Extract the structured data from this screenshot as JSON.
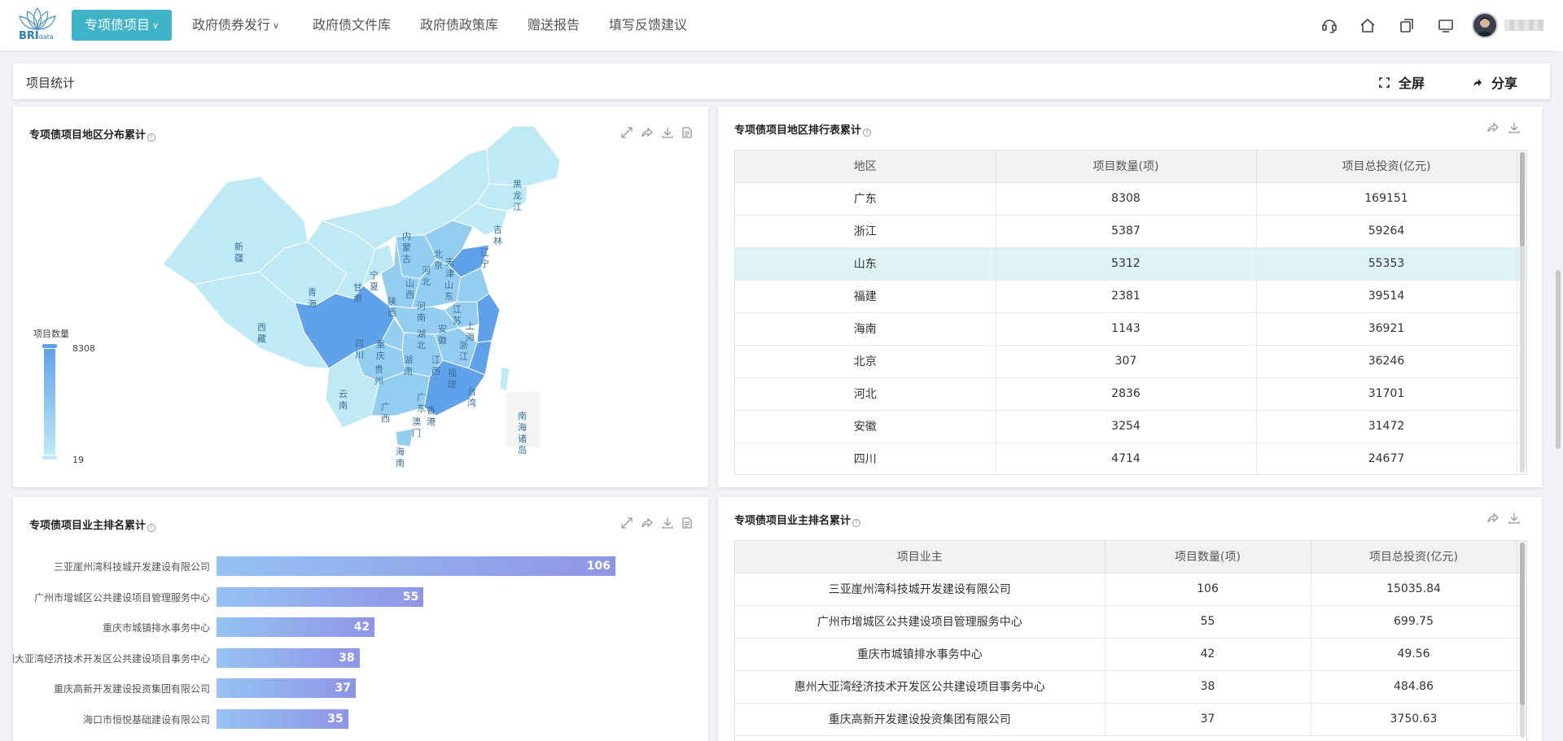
{
  "nav": {
    "logo_text": "BRI",
    "logo_sub": "data",
    "active": "专项债项目",
    "items": [
      "政府债券发行",
      "政府债文件库",
      "政府债政策库",
      "赠送报告",
      "填写反馈建议"
    ]
  },
  "statbar": {
    "title": "项目统计",
    "fullscreen": "全屏",
    "share": "分享"
  },
  "map_panel": {
    "title": "专项债项目地区分布累计",
    "legend_title": "项目数量",
    "legend_max": "8308",
    "legend_min": "19",
    "labels": {
      "xinjiang": "新疆",
      "xizang": "西藏",
      "qinghai": "青海",
      "gansu": "甘肃",
      "neimenggu": "内蒙古",
      "heilongjiang": "黑龙江",
      "jilin": "吉林",
      "liaoning": "辽宁",
      "beijing": "北京",
      "tianjin": "天津",
      "hebei": "河北",
      "shanxi": "山西",
      "shandong": "山东",
      "ningxia": "宁夏",
      "shaanxi": "陕西",
      "henan": "河南",
      "jiangsu": "江苏",
      "shanghai": "上海",
      "anhui": "安徽",
      "hubei": "湖北",
      "zhejiang": "浙江",
      "sichuan": "四川",
      "chongqing": "重庆",
      "hunan": "湖南",
      "jiangxi": "江西",
      "guizhou": "贵州",
      "fujian": "福建",
      "yunnan": "云南",
      "guangxi": "广西",
      "guangdong": "广东",
      "aomen": "澳门",
      "xianggang": "香港",
      "taiwan": "台湾",
      "hainan": "海南",
      "nanhai": "南海诸岛"
    },
    "colors": {
      "low": "#bfeaf5",
      "mid": "#93cdef",
      "high": "#5fa2ea"
    }
  },
  "region_table": {
    "title": "专项债项目地区排行表累计",
    "headers": [
      "地区",
      "项目数量(项)",
      "项目总投资(亿元)"
    ],
    "rows": [
      [
        "广东",
        "8308",
        "169151"
      ],
      [
        "浙江",
        "5387",
        "59264"
      ],
      [
        "山东",
        "5312",
        "55353"
      ],
      [
        "福建",
        "2381",
        "39514"
      ],
      [
        "海南",
        "1143",
        "36921"
      ],
      [
        "北京",
        "307",
        "36246"
      ],
      [
        "河北",
        "2836",
        "31701"
      ],
      [
        "安徽",
        "3254",
        "31472"
      ],
      [
        "四川",
        "4714",
        "24677"
      ]
    ]
  },
  "bar_panel": {
    "title": "专项债项目业主排名累计"
  },
  "chart_data": {
    "type": "bar",
    "categories": [
      "三亚崖州湾科技城开发建设有限公司",
      "广州市增城区公共建设项目管理服务中心",
      "重庆市城镇排水事务中心",
      "惠州大亚湾经济技术开发区公共建设项目事务中心",
      "重庆高新开发建设投资集团有限公司",
      "海口市恒悦基础建设有限公司"
    ],
    "values": [
      106,
      55,
      42,
      38,
      37,
      35
    ],
    "xlim": [
      0,
      106
    ],
    "orientation": "horizontal"
  },
  "owner_table": {
    "title": "专项债项目业主排名累计",
    "headers": [
      "项目业主",
      "项目数量(项)",
      "项目总投资(亿元)"
    ],
    "rows": [
      [
        "三亚崖州湾科技城开发建设有限公司",
        "106",
        "15035.84"
      ],
      [
        "广州市增城区公共建设项目管理服务中心",
        "55",
        "699.75"
      ],
      [
        "重庆市城镇排水事务中心",
        "42",
        "49.56"
      ],
      [
        "惠州大亚湾经济技术开发区公共建设项目事务中心",
        "38",
        "484.86"
      ],
      [
        "重庆高新开发建设投资集团有限公司",
        "37",
        "3750.63"
      ]
    ]
  }
}
